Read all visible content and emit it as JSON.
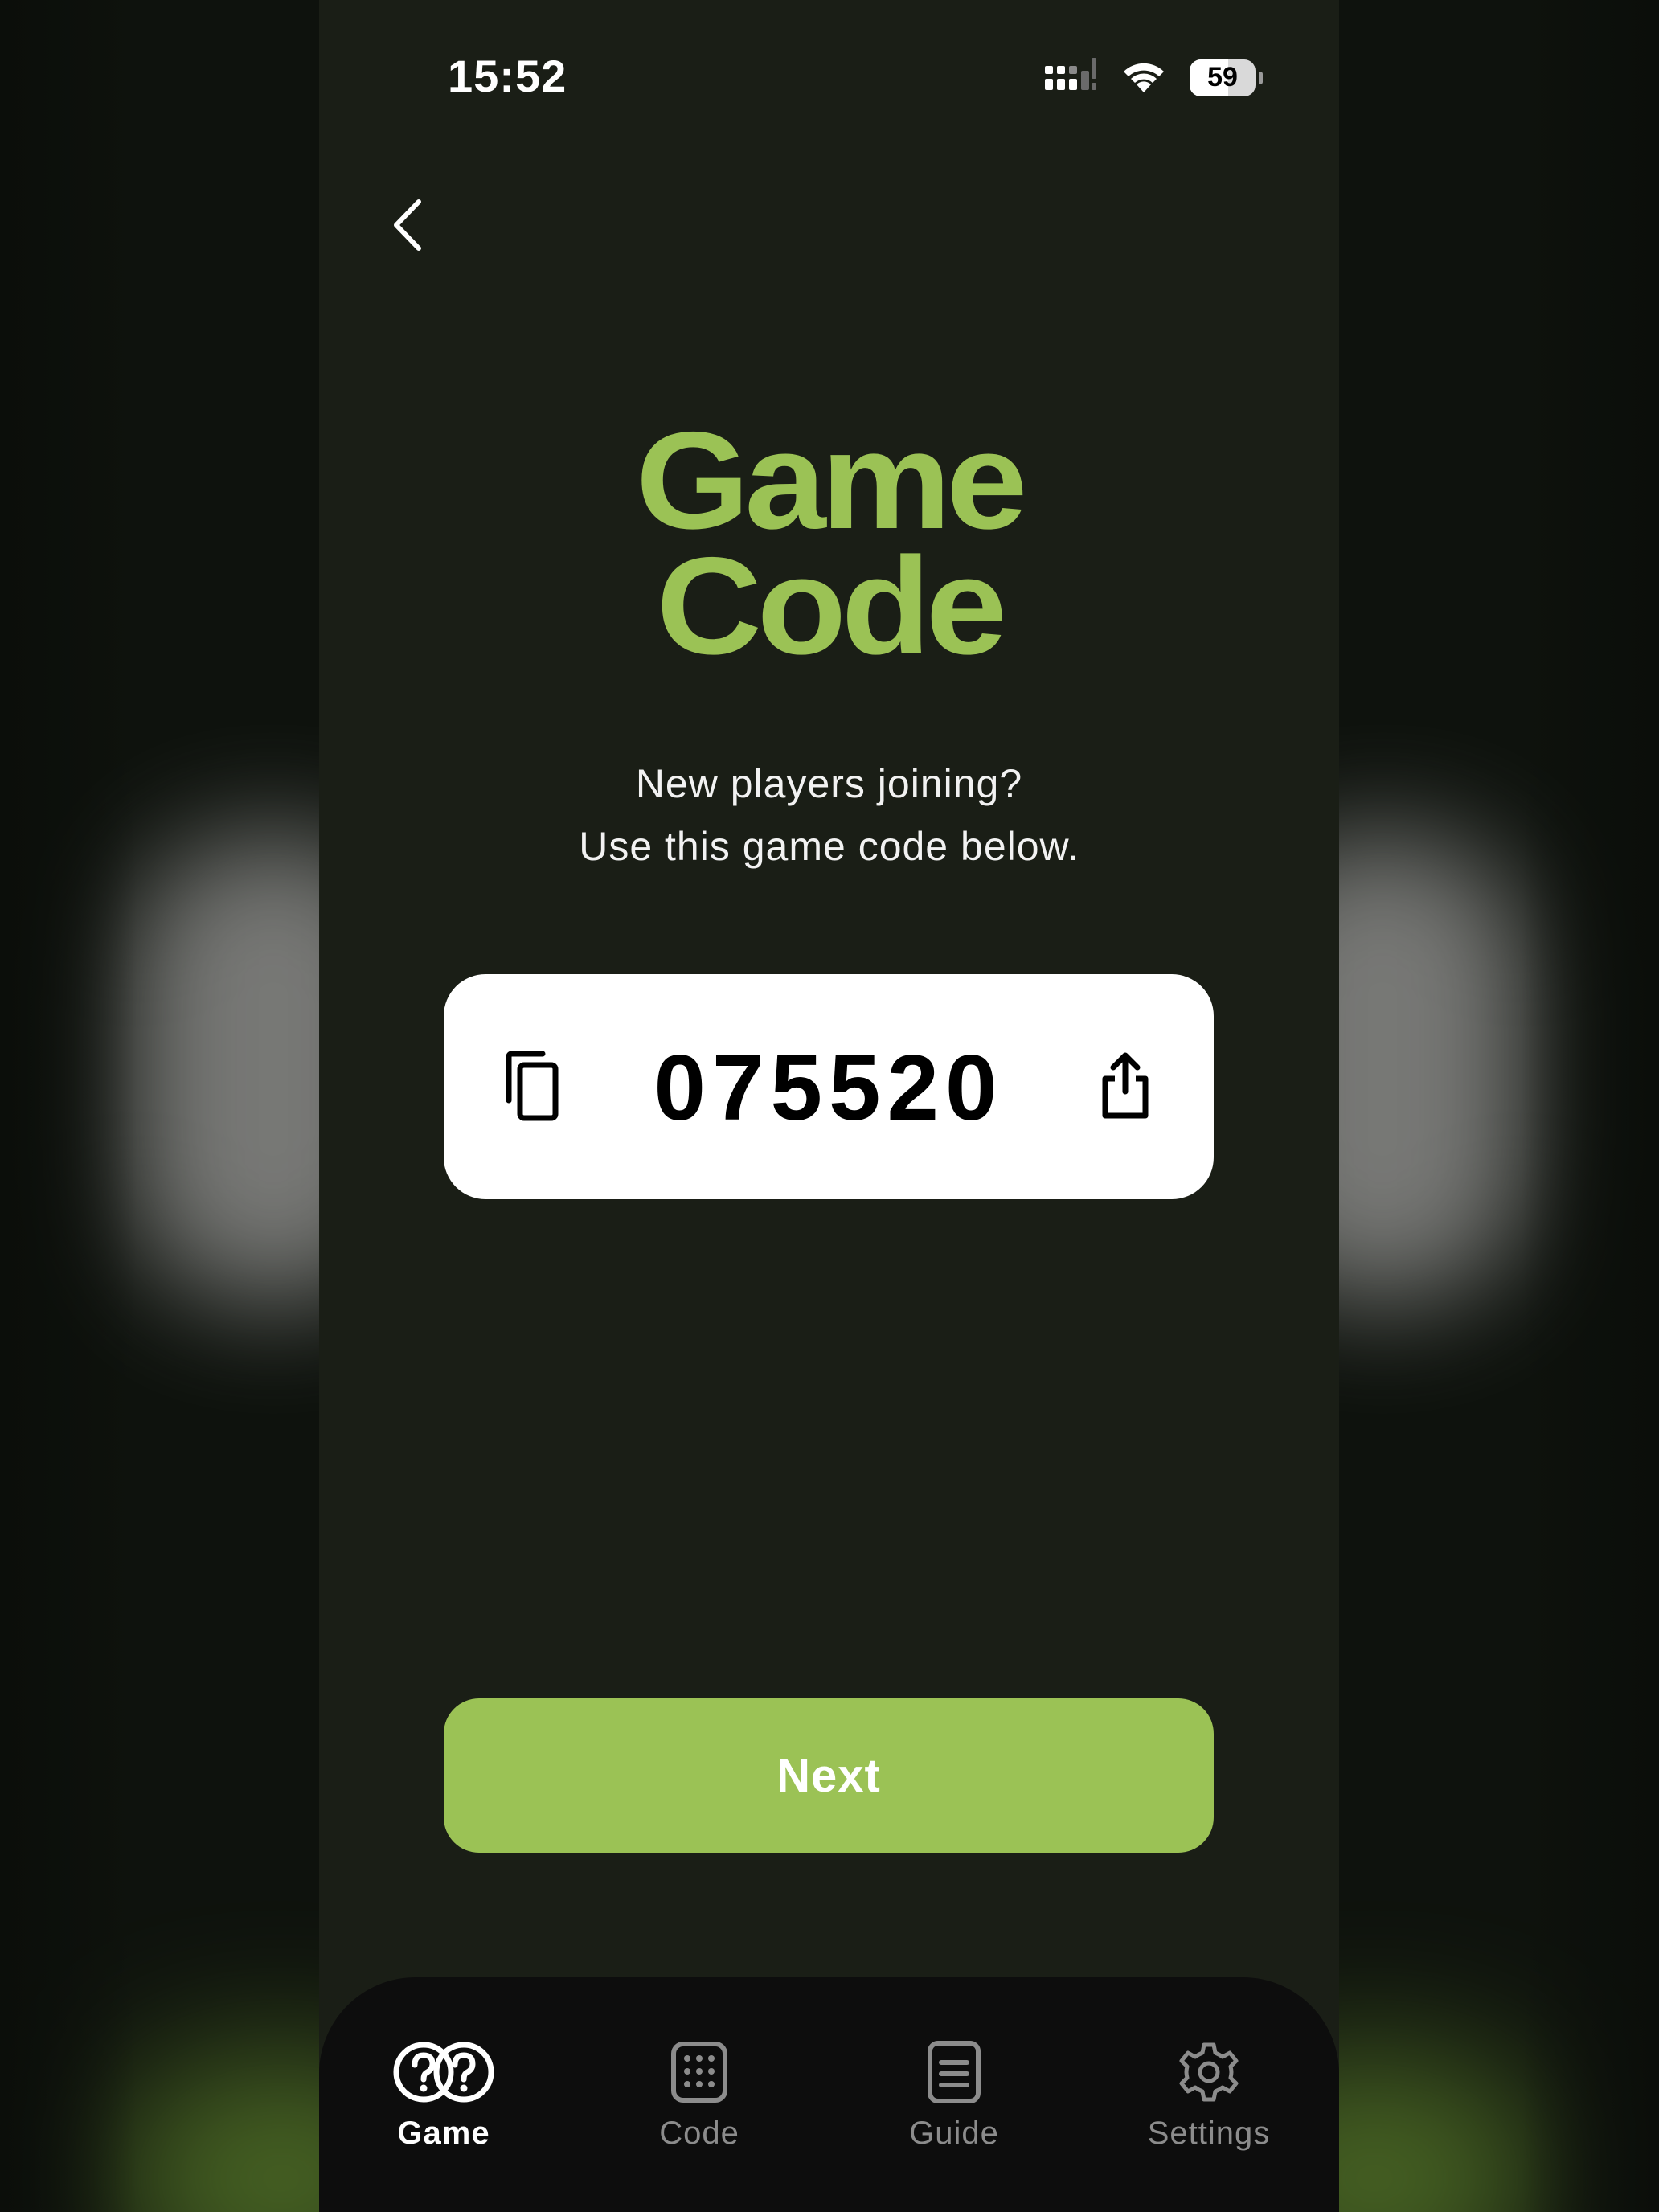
{
  "status_bar": {
    "time": "15:52",
    "battery_level": "59"
  },
  "header": {
    "title_line1": "Game",
    "title_line2": "Code",
    "subtitle_line1": "New players joining?",
    "subtitle_line2": "Use this game code below."
  },
  "code_card": {
    "code": "075520",
    "copy_icon": "copy-icon",
    "share_icon": "share-icon"
  },
  "actions": {
    "next_label": "Next"
  },
  "tabbar": {
    "items": [
      {
        "label": "Game",
        "icon": "double-question-icon",
        "active": true
      },
      {
        "label": "Code",
        "icon": "keypad-icon",
        "active": false
      },
      {
        "label": "Guide",
        "icon": "document-icon",
        "active": false
      },
      {
        "label": "Settings",
        "icon": "gear-icon",
        "active": false
      }
    ]
  },
  "colors": {
    "accent": "#9bc255",
    "background": "#1a1e16",
    "tabbar": "#0d0d0d",
    "card": "#ffffff"
  }
}
